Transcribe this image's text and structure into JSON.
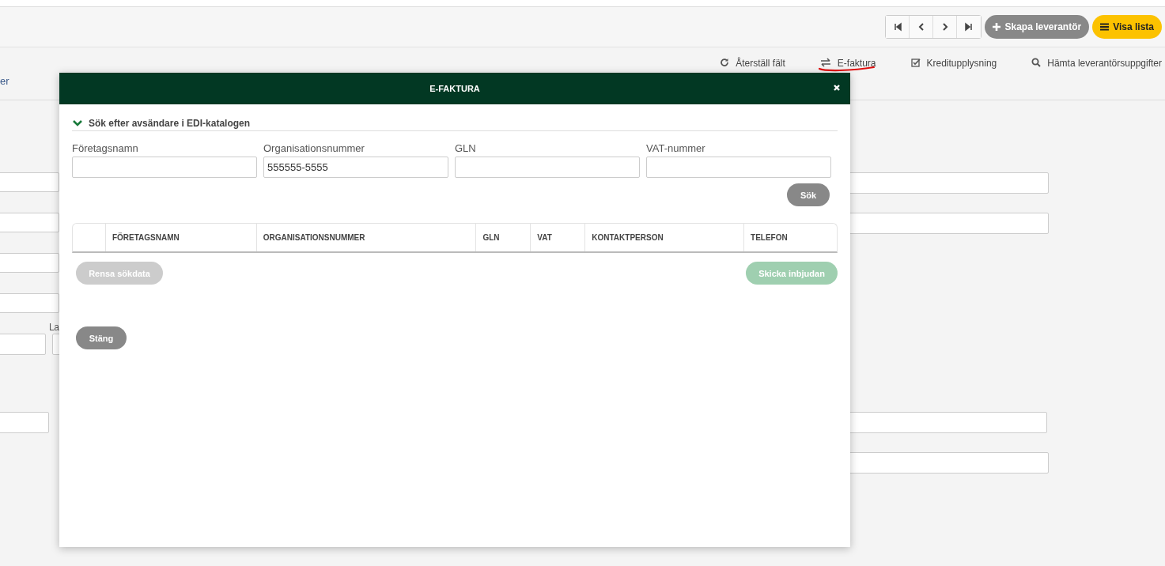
{
  "header": {
    "create_button": "Skapa leverantör",
    "list_button": "Visa lista"
  },
  "toolbar": {
    "actions": [
      {
        "label": "Återställ fält",
        "kind": "reset",
        "annotated": false
      },
      {
        "label": "E-faktura",
        "kind": "swap",
        "annotated": true
      },
      {
        "label": "Kreditupplysning",
        "kind": "check",
        "annotated": false
      },
      {
        "label": "Hämta leverantörsuppgifter",
        "kind": "search",
        "annotated": false
      }
    ]
  },
  "background": {
    "tab_text": "er",
    "field_label": "La"
  },
  "modal": {
    "title": "E-FAKTURA",
    "section": {
      "title": "Sök efter avsändare i EDI-katalogen",
      "expanded": true
    },
    "fields": [
      {
        "label": "Företagsnamn"
      },
      {
        "label": "Organisationsnummer",
        "value": "555555-5555"
      },
      {
        "label": "GLN"
      },
      {
        "label": "VAT-nummer"
      }
    ],
    "search_button": "Sök",
    "table": {
      "columns": [
        "FÖRETAGSNAMN",
        "ORGANISATIONSNUMMER",
        "GLN",
        "VAT",
        "KONTAKTPERSON",
        "TELEFON"
      ]
    },
    "clear_button": {
      "label": "Rensa sökdata",
      "disabled": true
    },
    "invite_button": {
      "label": "Skicka inbjudan",
      "disabled": true
    },
    "close_button": "Stäng"
  }
}
